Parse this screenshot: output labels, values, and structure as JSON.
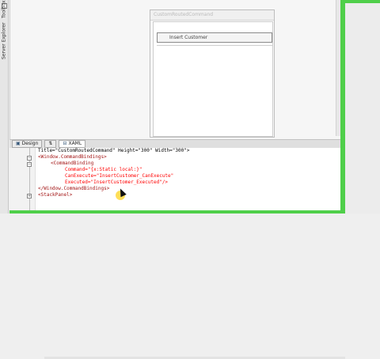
{
  "left_panel": {
    "tabs": [
      "Server Explorer",
      "Toolbox"
    ]
  },
  "designer": {
    "window_title": "CustomRoutedCommand",
    "button_label": "Insert Customer"
  },
  "tabs": [
    {
      "label": "Design",
      "icon": "design-icon"
    },
    {
      "label": "⇅",
      "icon": "swap-icon"
    },
    {
      "label": "XAML",
      "icon": "xaml-icon"
    }
  ],
  "code_lines": [
    "Title=\"CustomRoutedCommand\" Height=\"300\" Width=\"300\">",
    "<Window.CommandBindings>",
    "<CommandBinding",
    "Command=\"{x:Static local:}\"",
    "CanExecute=\"InsertCustomer_CanExecute\"",
    "Executed=\"InsertCustomer_Executed\"/>",
    "</Window.CommandBindings>",
    "<StackPanel>"
  ],
  "colors": {
    "frame_accent": "#4fcf4a",
    "xaml_tag": "#a31515",
    "xaml_attr": "#ff0000",
    "xaml_value": "#0000ff"
  }
}
